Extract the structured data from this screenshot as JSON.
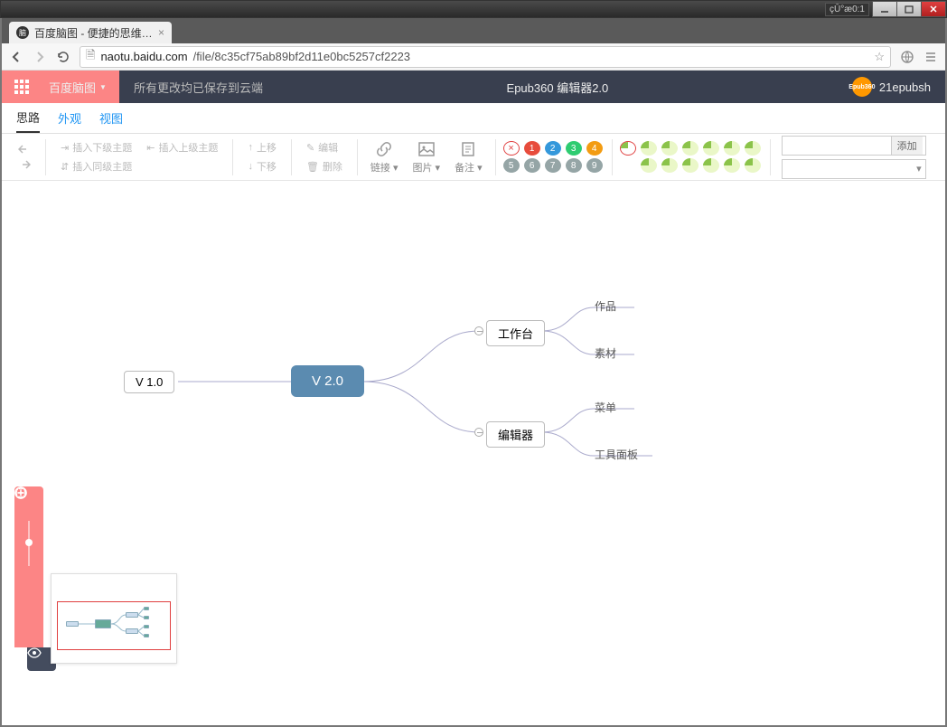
{
  "window": {
    "lang": "çŪ°æ0:1"
  },
  "tab": {
    "title": "百度脑图 - 便捷的思维工..."
  },
  "url": {
    "host": "naotu.baidu.com",
    "path": "/file/8c35cf75ab89bf2d11e0bc5257cf2223"
  },
  "header": {
    "brand": "百度脑图",
    "saveStatus": "所有更改均已保存到云端",
    "docTitle": "Epub360 编辑器2.0",
    "user": "21epubsh",
    "userBadge": "Epub360"
  },
  "appTabs": {
    "t1": "思路",
    "t2": "外观",
    "t3": "视图"
  },
  "toolbar": {
    "insertChild": "插入下级主题",
    "insertParent": "插入上级主题",
    "insertSibling": "插入同级主题",
    "moveUp": "上移",
    "moveDown": "下移",
    "edit": "编辑",
    "delete": "删除",
    "link": "链接",
    "image": "图片",
    "note": "备注",
    "addBtn": "添加",
    "priority": {
      "x": "×",
      "n1": "1",
      "n2": "2",
      "n3": "3",
      "n4": "4",
      "n5": "5",
      "n6": "6",
      "n7": "7",
      "n8": "8",
      "n9": "9"
    }
  },
  "mindmap": {
    "n0": "V 1.0",
    "root": "V 2.0",
    "c1": "工作台",
    "c2": "编辑器",
    "l1": "作品",
    "l2": "素材",
    "l3": "菜单",
    "l4": "工具面板"
  }
}
